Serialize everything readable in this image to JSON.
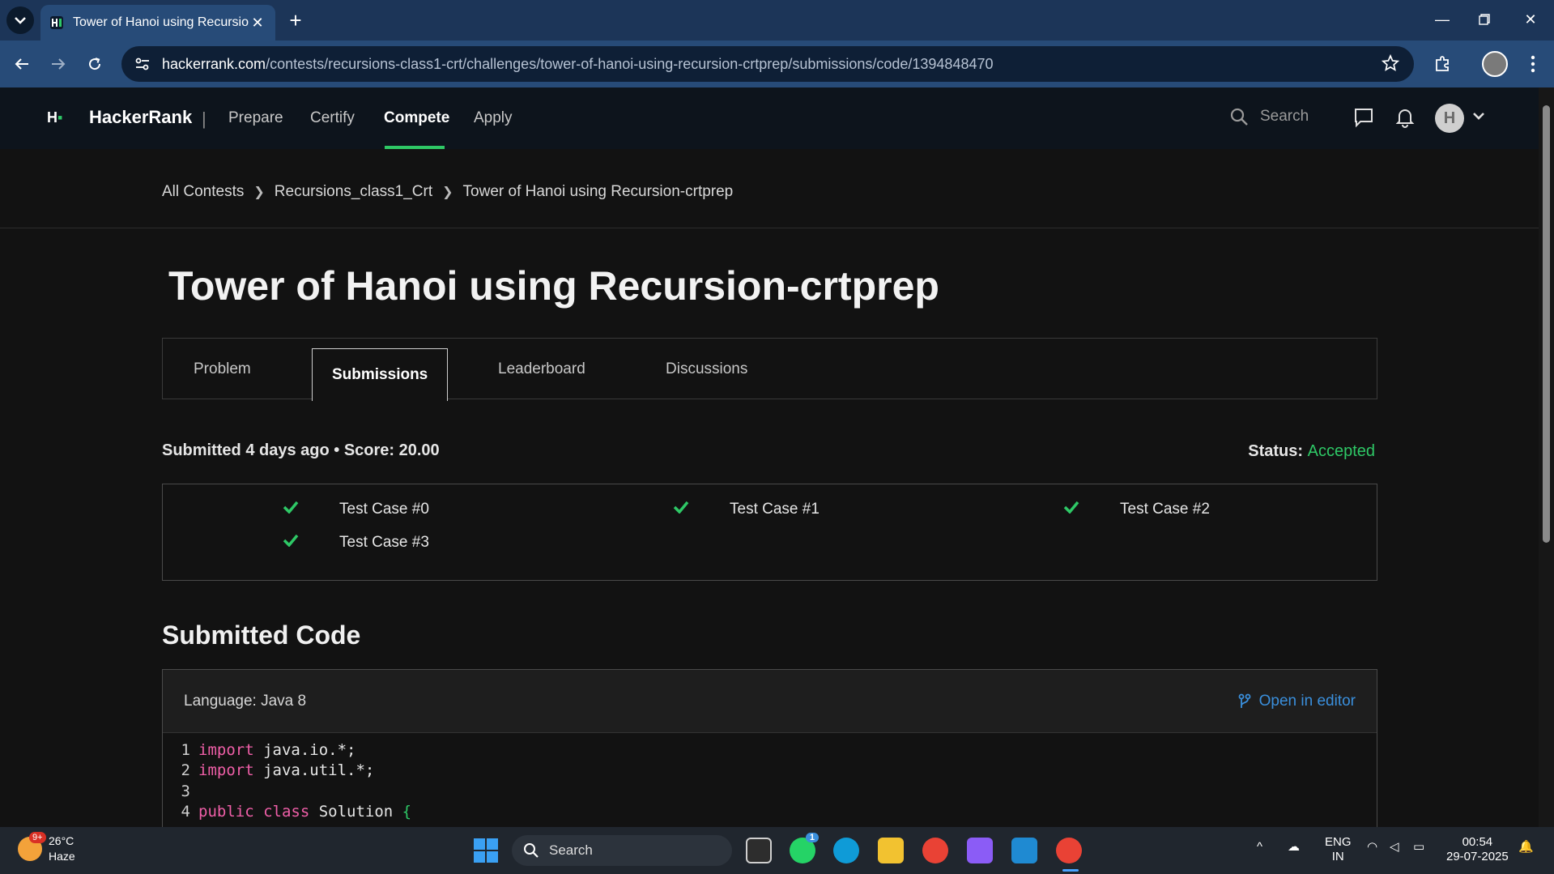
{
  "browser": {
    "tab_title": "Tower of Hanoi using Recursion",
    "url_host": "hackerrank.com",
    "url_path": "/contests/recursions-class1-crt/challenges/tower-of-hanoi-using-recursion-crtprep/submissions/code/1394848470"
  },
  "header": {
    "brand": "HackerRank",
    "nav": [
      "Prepare",
      "Certify",
      "Compete",
      "Apply"
    ],
    "active_nav": "Compete",
    "search_placeholder": "Search",
    "avatar_initial": "H"
  },
  "breadcrumb": [
    "All Contests",
    "Recursions_class1_Crt",
    "Tower of Hanoi using Recursion-crtprep"
  ],
  "page_title": "Tower of Hanoi using Recursion-crtprep",
  "tabs": [
    "Problem",
    "Submissions",
    "Leaderboard",
    "Discussions"
  ],
  "active_tab": "Submissions",
  "submission": {
    "summary": "Submitted 4 days ago • Score: 20.00",
    "status_label": "Status:",
    "status_value": "Accepted"
  },
  "test_cases": [
    "Test Case #0",
    "Test Case #1",
    "Test Case #2",
    "Test Case #3"
  ],
  "code_section": {
    "heading": "Submitted Code",
    "language": "Language: Java 8",
    "open_editor": "Open in editor",
    "lines": [
      {
        "n": "1",
        "kw": "import",
        "rest": " java.io.*;"
      },
      {
        "n": "2",
        "kw": "import",
        "rest": " java.util.*;"
      },
      {
        "n": "3",
        "kw": "",
        "rest": ""
      },
      {
        "n": "4",
        "kw": "public class",
        "rest": " Solution "
      }
    ]
  },
  "taskbar": {
    "weather_temp": "26°C",
    "weather_desc": "Haze",
    "weather_badge": "9+",
    "search": "Search",
    "whatsapp_badge": "1",
    "lang_top": "ENG",
    "lang_bottom": "IN",
    "time": "00:54",
    "date": "29-07-2025"
  },
  "colors": {
    "accent_green": "#2ec866",
    "link_blue": "#3a8fdc",
    "keyword_pink": "#f05fa8"
  }
}
